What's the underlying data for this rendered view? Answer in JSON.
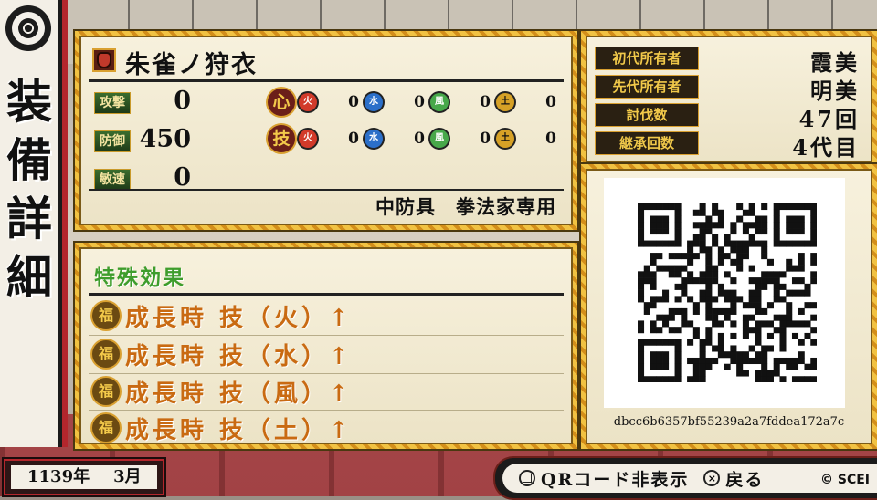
{
  "title": "装備詳細",
  "item": {
    "name": "朱雀ノ狩衣",
    "stats": [
      {
        "label": "攻撃",
        "value": "0"
      },
      {
        "label": "防御",
        "value": "450"
      },
      {
        "label": "敏速",
        "value": "0"
      }
    ],
    "affinity": [
      {
        "label": "心",
        "elements": [
          {
            "icon": "火",
            "value": "0"
          },
          {
            "icon": "水",
            "value": "0"
          },
          {
            "icon": "風",
            "value": "0"
          },
          {
            "icon": "土",
            "value": "0"
          }
        ]
      },
      {
        "label": "技",
        "elements": [
          {
            "icon": "火",
            "value": "0"
          },
          {
            "icon": "水",
            "value": "0"
          },
          {
            "icon": "風",
            "value": "0"
          },
          {
            "icon": "土",
            "value": "0"
          }
        ]
      }
    ],
    "type": "中防具　拳法家専用"
  },
  "effects": {
    "heading": "特殊効果",
    "icon": "福",
    "rows": [
      "成長時 技（火）↑",
      "成長時 技（水）↑",
      "成長時 技（風）↑",
      "成長時 技（土）↑"
    ]
  },
  "owners": [
    {
      "label": "初代所有者",
      "value": "霞美"
    },
    {
      "label": "先代所有者",
      "value": "明美"
    },
    {
      "label": "討伐数",
      "value": "47回"
    },
    {
      "label": "継承回数",
      "value": "4代目"
    }
  ],
  "qr": {
    "code": "dbcc6b6357bf55239a2a7fddea172a7c"
  },
  "date": {
    "year": "1139年",
    "month": "3月"
  },
  "actions": {
    "qr_toggle_icon": "□",
    "qr_toggle_label": "QRコード非表示",
    "back_icon": "×",
    "back_label": "戻る"
  },
  "copyright": "© SCEI",
  "colors": {
    "panel_border": "#e6a923",
    "title_red": "#b3262c",
    "effect_text": "#c96a12",
    "effect_heading": "#3e9d2c"
  }
}
